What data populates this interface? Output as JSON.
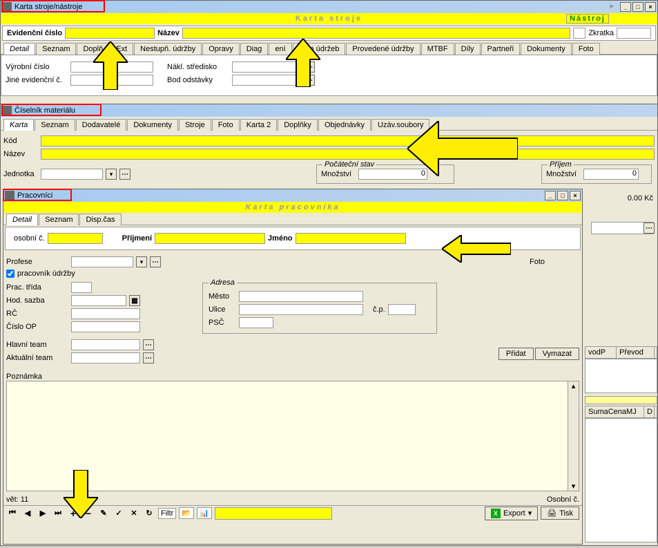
{
  "window1": {
    "title": "Karta stroje/nástroje",
    "header": "Karta stroje",
    "toggle": "Nástroj",
    "zkratka": "Zkratka",
    "evidcislo": "Evidenční číslo",
    "nazev": "Název",
    "tabs": [
      "Detail",
      "Seznam",
      "Doplň",
      "Ext",
      "Nestupň. údržby",
      "Opravy",
      "Diag",
      "ení",
      "Plán údržeb",
      "Provedené údržby",
      "MTBF",
      "Díly",
      "Partneři",
      "Dokumenty",
      "Foto"
    ],
    "vyrobni": "Výrobní číslo",
    "jineevid": "Jiné evidenční č.",
    "naklstred": "Nákl. středisko",
    "bododst": "Bod odstávky"
  },
  "window2": {
    "title": "Číselník materiálu",
    "tabs": [
      "Karta",
      "Seznam",
      "Dodavatelé",
      "Dokumenty",
      "Stroje",
      "Foto",
      "Karta 2",
      "Doplňky",
      "Objednávky",
      "Uzáv.soubory"
    ],
    "kod": "Kód",
    "nazev": "Název",
    "jednotka": "Jednotka",
    "pocstav": "Počáteční stav",
    "mnozstvi": "Množství",
    "mnozval": "0",
    "prijem": "Příjem",
    "prijval": "0",
    "cena": "0.00 Kč",
    "gridcols1": [
      "vodP",
      "Převod"
    ],
    "gridcols2": [
      "SumaCenaMJ",
      "D"
    ]
  },
  "window3": {
    "title": "Pracovníci",
    "header": "Karta pracovníka",
    "tabs": [
      "Detail",
      "Seznam",
      "Disp.čas"
    ],
    "osobni": "osobní č.",
    "prijmeni": "Příjmení",
    "jmeno": "Jméno",
    "profese": "Profese",
    "foto": "Foto",
    "pracudrzby": "pracovník údržby",
    "practrida": "Prac. třída",
    "hodsazba": "Hod. sazba",
    "rc": "RČ",
    "cisloop": "Číslo OP",
    "hlavniteam": "Hlavní team",
    "aktualniteam": "Aktuální team",
    "adresa": "Adresa",
    "mesto": "Město",
    "ulice": "Ulice",
    "cp": "č.p.",
    "psc": "PSČ",
    "pridat": "Přidat",
    "vymazat": "Vymazat",
    "poznamka": "Poznámka",
    "vet": "vět: 11",
    "osobni2": "Osobní č.",
    "filtr": "Filtr",
    "export": "Export",
    "tisk": "Tisk"
  }
}
